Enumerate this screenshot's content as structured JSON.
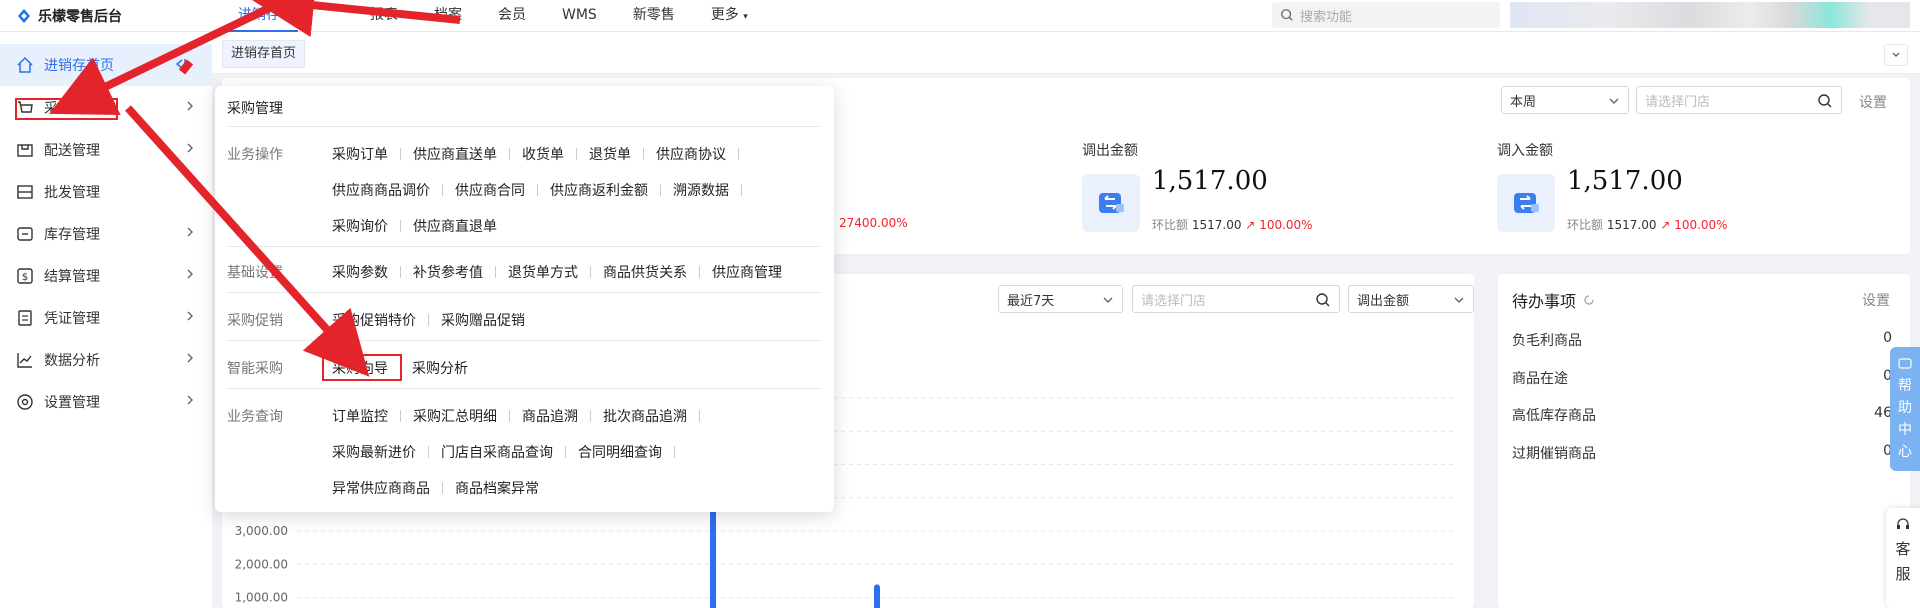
{
  "app": {
    "logo_text": "乐檬零售后台",
    "top_nav": [
      "进销存",
      "报表",
      "档案",
      "会员",
      "WMS",
      "新零售",
      "更多"
    ],
    "search_placeholder": "搜索功能"
  },
  "sidebar": {
    "items": [
      {
        "label": "进销存首页",
        "icon": "home-icon"
      },
      {
        "label": "采购管理",
        "icon": "cart-icon"
      },
      {
        "label": "配送管理",
        "icon": "delivery-icon"
      },
      {
        "label": "批发管理",
        "icon": "wholesale-icon"
      },
      {
        "label": "库存管理",
        "icon": "inventory-icon"
      },
      {
        "label": "结算管理",
        "icon": "settlement-icon"
      },
      {
        "label": "凭证管理",
        "icon": "voucher-icon"
      },
      {
        "label": "数据分析",
        "icon": "chart-icon"
      },
      {
        "label": "设置管理",
        "icon": "settings-icon"
      }
    ]
  },
  "tabs": {
    "active": "进销存首页"
  },
  "filters": {
    "period": "本周",
    "store_placeholder": "请选择门店",
    "settings": "设置"
  },
  "metrics": {
    "partial_pct": "27400.00%",
    "out": {
      "label": "调出金额",
      "value": "1,517.00",
      "ratio_label": "环比额",
      "ratio_value": "1517.00",
      "ratio_pct": "100.00%"
    },
    "in": {
      "label": "调入金额",
      "value": "1,517.00",
      "ratio_label": "环比额",
      "ratio_value": "1517.00",
      "ratio_pct": "100.00%"
    }
  },
  "chart_filters": {
    "range": "最近7天",
    "store_placeholder": "请选择门店",
    "metric": "调出金额"
  },
  "chart_data": {
    "type": "bar",
    "ylabel": "",
    "y_ticks": [
      "3,000.00",
      "2,000.00",
      "1,000.00"
    ],
    "ylim": [
      0,
      3000
    ],
    "series": [
      {
        "values": [
          6100,
          1400
        ]
      }
    ]
  },
  "todo": {
    "title": "待办事项",
    "settings": "设置",
    "items": [
      {
        "label": "负毛利商品",
        "count": "0"
      },
      {
        "label": "商品在途",
        "count": "0"
      },
      {
        "label": "高低库存商品",
        "count": "46"
      },
      {
        "label": "过期催销商品",
        "count": "0"
      }
    ]
  },
  "help": {
    "help_chars": [
      "帮",
      "助",
      "中",
      "心"
    ],
    "service_chars": [
      "客",
      "服"
    ]
  },
  "dropdown": {
    "title": "采购管理",
    "sections": [
      {
        "category": "业务操作",
        "lines": [
          [
            "采购订单",
            "供应商直送单",
            "收货单",
            "退货单",
            "供应商协议"
          ],
          [
            "供应商商品调价",
            "供应商合同",
            "供应商返利金额",
            "溯源数据"
          ],
          [
            "采购询价",
            "供应商直退单"
          ]
        ]
      },
      {
        "category": "基础设置",
        "lines": [
          [
            "采购参数",
            "补货参考值",
            "退货单方式",
            "商品供货关系",
            "供应商管理"
          ]
        ]
      },
      {
        "category": "采购促销",
        "lines": [
          [
            "采购促销特价",
            "采购赠品促销"
          ]
        ]
      },
      {
        "category": "智能采购",
        "lines": [
          [
            "采购向导",
            "采购分析"
          ]
        ]
      },
      {
        "category": "业务查询",
        "lines": [
          [
            "订单监控",
            "采购汇总明细",
            "商品追溯",
            "批次商品追溯"
          ],
          [
            "采购最新进价",
            "门店自采商品查询",
            "合同明细查询"
          ],
          [
            "异常供应商商品",
            "商品档案异常"
          ]
        ]
      }
    ]
  },
  "colors": {
    "accent": "#2f6fed",
    "annotation": "#e3242b",
    "positive": "#f5222d"
  }
}
